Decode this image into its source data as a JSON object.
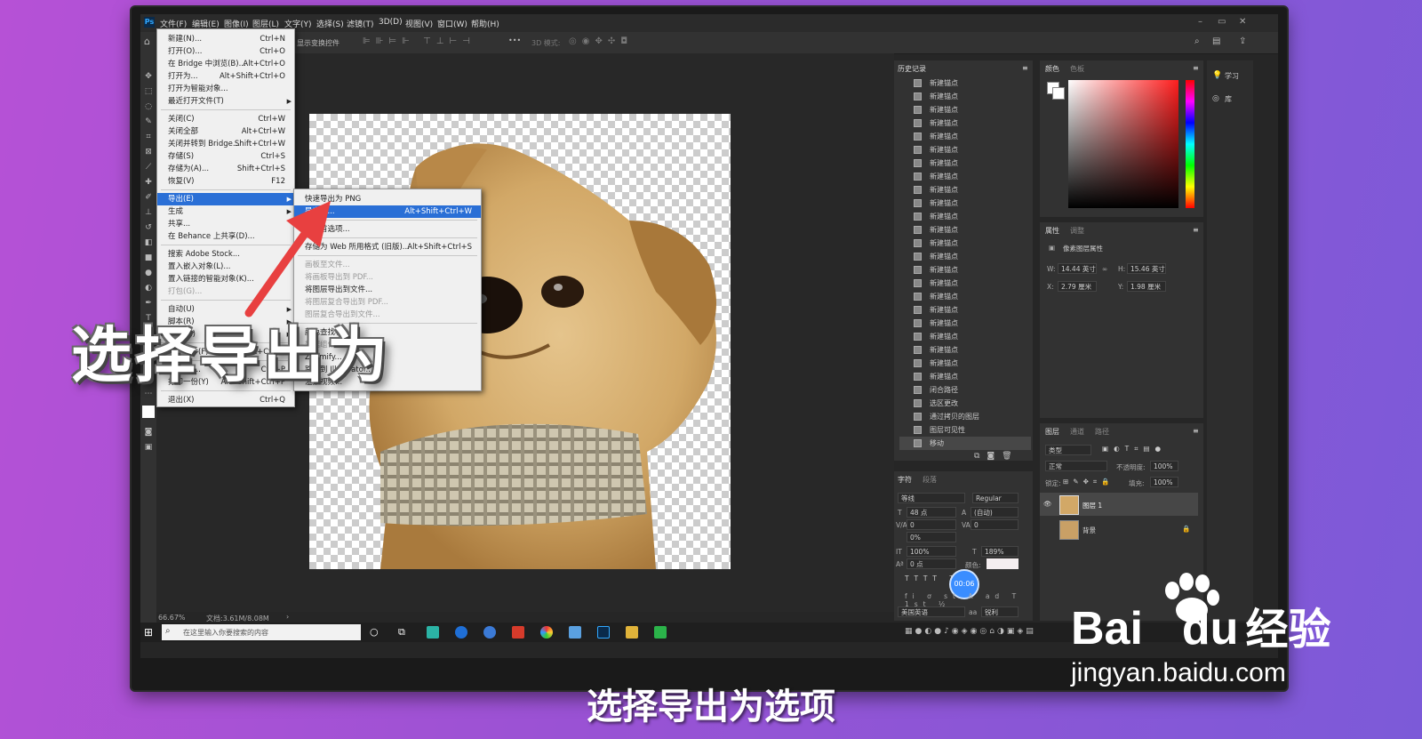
{
  "menubar": {
    "logo": "Ps",
    "items": [
      "文件(F)",
      "编辑(E)",
      "图像(I)",
      "图层(L)",
      "文字(Y)",
      "选择(S)",
      "滤镜(T)",
      "3D(D)",
      "视图(V)",
      "窗口(W)",
      "帮助(H)"
    ],
    "min": "–",
    "max": "▭",
    "close": "✕"
  },
  "options": {
    "show_transform": "显示变换控件",
    "mode3d": "3D 模式:",
    "more": "•••"
  },
  "file_menu": [
    {
      "label": "新建(N)...",
      "sc": "Ctrl+N"
    },
    {
      "label": "打开(O)...",
      "sc": "Ctrl+O"
    },
    {
      "label": "在 Bridge 中浏览(B)...",
      "sc": "Alt+Ctrl+O"
    },
    {
      "label": "打开为...",
      "sc": "Alt+Shift+Ctrl+O"
    },
    {
      "label": "打开为智能对象...",
      "sc": ""
    },
    {
      "label": "最近打开文件(T)",
      "sc": "",
      "sub": true
    },
    {
      "label": "关闭(C)",
      "sc": "Ctrl+W",
      "sep": true
    },
    {
      "label": "关闭全部",
      "sc": "Alt+Ctrl+W"
    },
    {
      "label": "关闭并转到 Bridge...",
      "sc": "Shift+Ctrl+W"
    },
    {
      "label": "存储(S)",
      "sc": "Ctrl+S"
    },
    {
      "label": "存储为(A)...",
      "sc": "Shift+Ctrl+S"
    },
    {
      "label": "恢复(V)",
      "sc": "F12"
    },
    {
      "label": "导出(E)",
      "sc": "",
      "sub": true,
      "hl": true,
      "sep": true
    },
    {
      "label": "生成",
      "sc": "",
      "sub": true
    },
    {
      "label": "共享...",
      "sc": ""
    },
    {
      "label": "在 Behance 上共享(D)...",
      "sc": ""
    },
    {
      "label": "搜索 Adobe Stock...",
      "sc": "",
      "sep": true
    },
    {
      "label": "置入嵌入对象(L)...",
      "sc": ""
    },
    {
      "label": "置入链接的智能对象(K)...",
      "sc": ""
    },
    {
      "label": "打包(G)...",
      "sc": "",
      "dis": true
    },
    {
      "label": "自动(U)",
      "sc": "",
      "sub": true,
      "sep": true
    },
    {
      "label": "脚本(R)",
      "sc": "",
      "sub": true
    },
    {
      "label": "导入(M)",
      "sc": "",
      "sub": true
    },
    {
      "label": "文件简介(F)...",
      "sc": "Alt+Shift+Ctrl+I",
      "sep": true
    },
    {
      "label": "打印(P)...",
      "sc": "Ctrl+P",
      "sep": true
    },
    {
      "label": "打印一份(Y)",
      "sc": "Alt+Shift+Ctrl+P"
    },
    {
      "label": "退出(X)",
      "sc": "Ctrl+Q",
      "sep": true
    }
  ],
  "export_menu": [
    {
      "label": "快速导出为 PNG",
      "sc": ""
    },
    {
      "label": "导出为...",
      "sc": "Alt+Shift+Ctrl+W",
      "hl": true
    },
    {
      "label": "导出首选项...",
      "sc": "",
      "sep": true
    },
    {
      "label": "存储为 Web 所用格式 (旧版)...",
      "sc": "Alt+Shift+Ctrl+S",
      "sep": true
    },
    {
      "label": "画板至文件...",
      "sc": "",
      "dis": true,
      "sep": true
    },
    {
      "label": "将画板导出到 PDF...",
      "sc": "",
      "dis": true
    },
    {
      "label": "将图层导出到文件...",
      "sc": ""
    },
    {
      "label": "将图层复合导出到 PDF...",
      "sc": "",
      "dis": true
    },
    {
      "label": "图层复合导出到文件...",
      "sc": "",
      "dis": true
    },
    {
      "label": "颜色查找表...",
      "sc": "",
      "sep": true
    },
    {
      "label": "数据组作为文件(D)...",
      "sc": "",
      "dis": true
    },
    {
      "label": "Zoomify...",
      "sc": ""
    },
    {
      "label": "路径到 Illustrator...",
      "sc": ""
    },
    {
      "label": "渲染视频...",
      "sc": ""
    }
  ],
  "status": {
    "zoom": "66.67%",
    "doc": "文档:3.61M/8.08M"
  },
  "history": {
    "tab": "历史记录",
    "rows": [
      "新建锚点",
      "新建锚点",
      "新建锚点",
      "新建锚点",
      "新建锚点",
      "新建锚点",
      "新建锚点",
      "新建锚点",
      "新建锚点",
      "新建锚点",
      "新建锚点",
      "新建锚点",
      "新建锚点",
      "新建锚点",
      "新建锚点",
      "新建锚点",
      "新建锚点",
      "新建锚点",
      "新建锚点",
      "新建锚点",
      "新建锚点",
      "新建锚点",
      "新建锚点",
      "闭合路径",
      "选区更改",
      "通过拷贝的图层",
      "图层可见性",
      "移动"
    ]
  },
  "color": {
    "tab1": "颜色",
    "tab2": "色板"
  },
  "learn": {
    "learn": "学习",
    "lib": "库"
  },
  "props": {
    "tab1": "属性",
    "tab2": "调整",
    "title": "像素图层属性",
    "w_label": "W:",
    "w": "14.44 英寸",
    "link": "∞",
    "h_label": "H:",
    "h": "15.46 英寸",
    "x_label": "X:",
    "x": "2.79 厘米",
    "y_label": "Y:",
    "y": "1.98 厘米"
  },
  "char": {
    "tab1": "字符",
    "tab2": "段落",
    "font": "等线",
    "style": "Regular",
    "size": "48 点",
    "leading": "(自动)",
    "va": "0",
    "tracking": "0",
    "scale_label": "0%",
    "vscale": "100%",
    "hscale": "189%",
    "baseline": "0 点",
    "color_label": "颜色:",
    "lang": "美国英语",
    "aa": "锐利",
    "timer": "00:06"
  },
  "layers": {
    "tab1": "图层",
    "tab2": "通道",
    "tab3": "路径",
    "filter": "类型",
    "blend": "正常",
    "opacity_label": "不透明度:",
    "opacity": "100%",
    "lock_label": "锁定:",
    "fill_label": "填充:",
    "fill": "100%",
    "items": [
      {
        "name": "图层 1"
      },
      {
        "name": "背景"
      }
    ]
  },
  "taskbar": {
    "search": "在这里输入你要搜索的内容"
  },
  "overlay": {
    "caption": "选择导出为",
    "subtitle": "选择导出为选项",
    "wm_brand": "Bai",
    "wm_du": "du",
    "wm_cn": "经验",
    "wm_url": "jingyan.baidu.com"
  }
}
